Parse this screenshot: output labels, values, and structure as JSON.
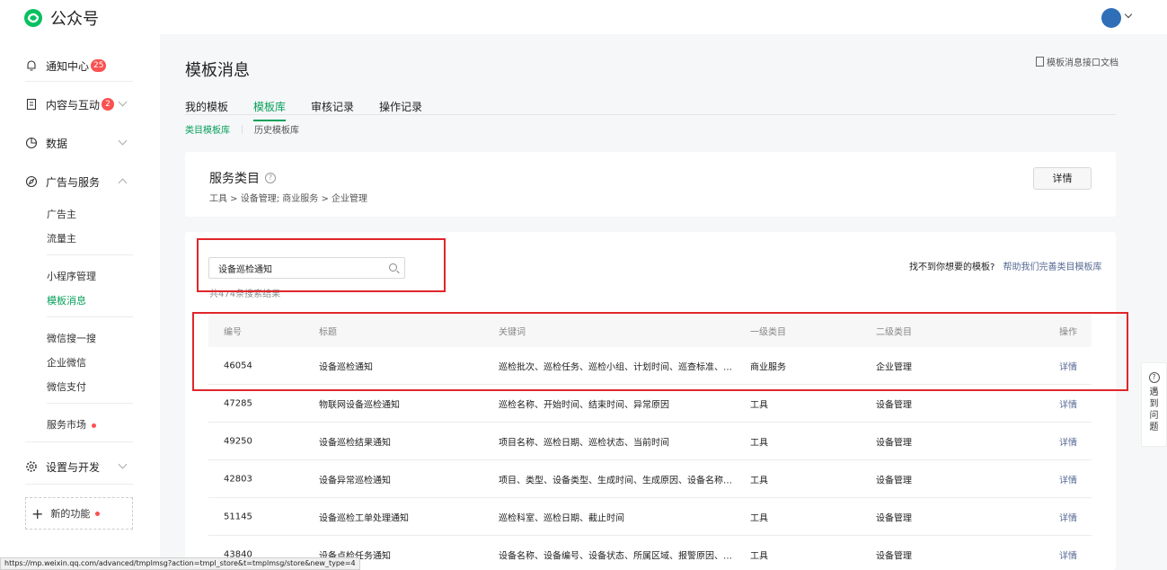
{
  "brand": {
    "name": "公众号"
  },
  "sidebar": {
    "notify": {
      "label": "通知中心",
      "badge": "25"
    },
    "content": {
      "label": "内容与互动",
      "badge": "2"
    },
    "data": {
      "label": "数据"
    },
    "ads": {
      "label": "广告与服务",
      "items": [
        "广告主",
        "流量主",
        "小程序管理",
        "模板消息",
        "微信搜一搜",
        "企业微信",
        "微信支付",
        "服务市场"
      ]
    },
    "settings": {
      "label": "设置与开发"
    },
    "new_feature": {
      "label": "新的功能"
    }
  },
  "page": {
    "title": "模板消息",
    "doc_link": "模板消息接口文档",
    "tabs": [
      "我的模板",
      "模板库",
      "审核记录",
      "操作记录"
    ],
    "subtabs": [
      "类目模板库",
      "历史模板库"
    ]
  },
  "service": {
    "title": "服务类目",
    "path": "工具 > 设备管理; 商业服务 > 企业管理",
    "detail_button": "详情"
  },
  "search": {
    "value": "设备巡检通知",
    "result_count": "共474条搜索结果",
    "help_text": "找不到你想要的模板?",
    "help_link": "帮助我们完善类目模板库"
  },
  "table": {
    "headers": [
      "编号",
      "标题",
      "关键词",
      "一级类目",
      "二级类目",
      "操作"
    ],
    "rows": [
      {
        "id": "46054",
        "title": "设备巡检通知",
        "keywords": "巡检批次、巡检任务、巡检小组、计划时间、巡查标准、设...",
        "cat1": "商业服务",
        "cat2": "企业管理",
        "op": "详情"
      },
      {
        "id": "47285",
        "title": "物联网设备巡检通知",
        "keywords": "巡检名称、开始时间、结束时间、异常原因",
        "cat1": "工具",
        "cat2": "设备管理",
        "op": "详情"
      },
      {
        "id": "49250",
        "title": "设备巡检结果通知",
        "keywords": "项目名称、巡检日期、巡检状态、当前时间",
        "cat1": "工具",
        "cat2": "设备管理",
        "op": "详情"
      },
      {
        "id": "42803",
        "title": "设备异常巡检通知",
        "keywords": "项目、类型、设备类型、生成时间、生成原因、设备名称、...",
        "cat1": "工具",
        "cat2": "设备管理",
        "op": "详情"
      },
      {
        "id": "51145",
        "title": "设备巡检工单处理通知",
        "keywords": "巡检科室、巡检日期、截止时间",
        "cat1": "工具",
        "cat2": "设备管理",
        "op": "详情"
      },
      {
        "id": "43840",
        "title": "设备点检任务通知",
        "keywords": "设备名称、设备编号、设备状态、所属区域、报警原因、所...",
        "cat1": "工具",
        "cat2": "设备管理",
        "op": "详情"
      }
    ]
  },
  "side_help": {
    "label_chars": [
      "遇",
      "到",
      "问",
      "题"
    ]
  },
  "status_url": "https://mp.weixin.qq.com/advanced/tmplmsg?action=tmpl_store&t=tmplmsg/store&new_type=4",
  "colors": {
    "accent": "#07a05a",
    "link": "#576b95",
    "badge": "#fa5151",
    "highlight": "#e0262b"
  }
}
